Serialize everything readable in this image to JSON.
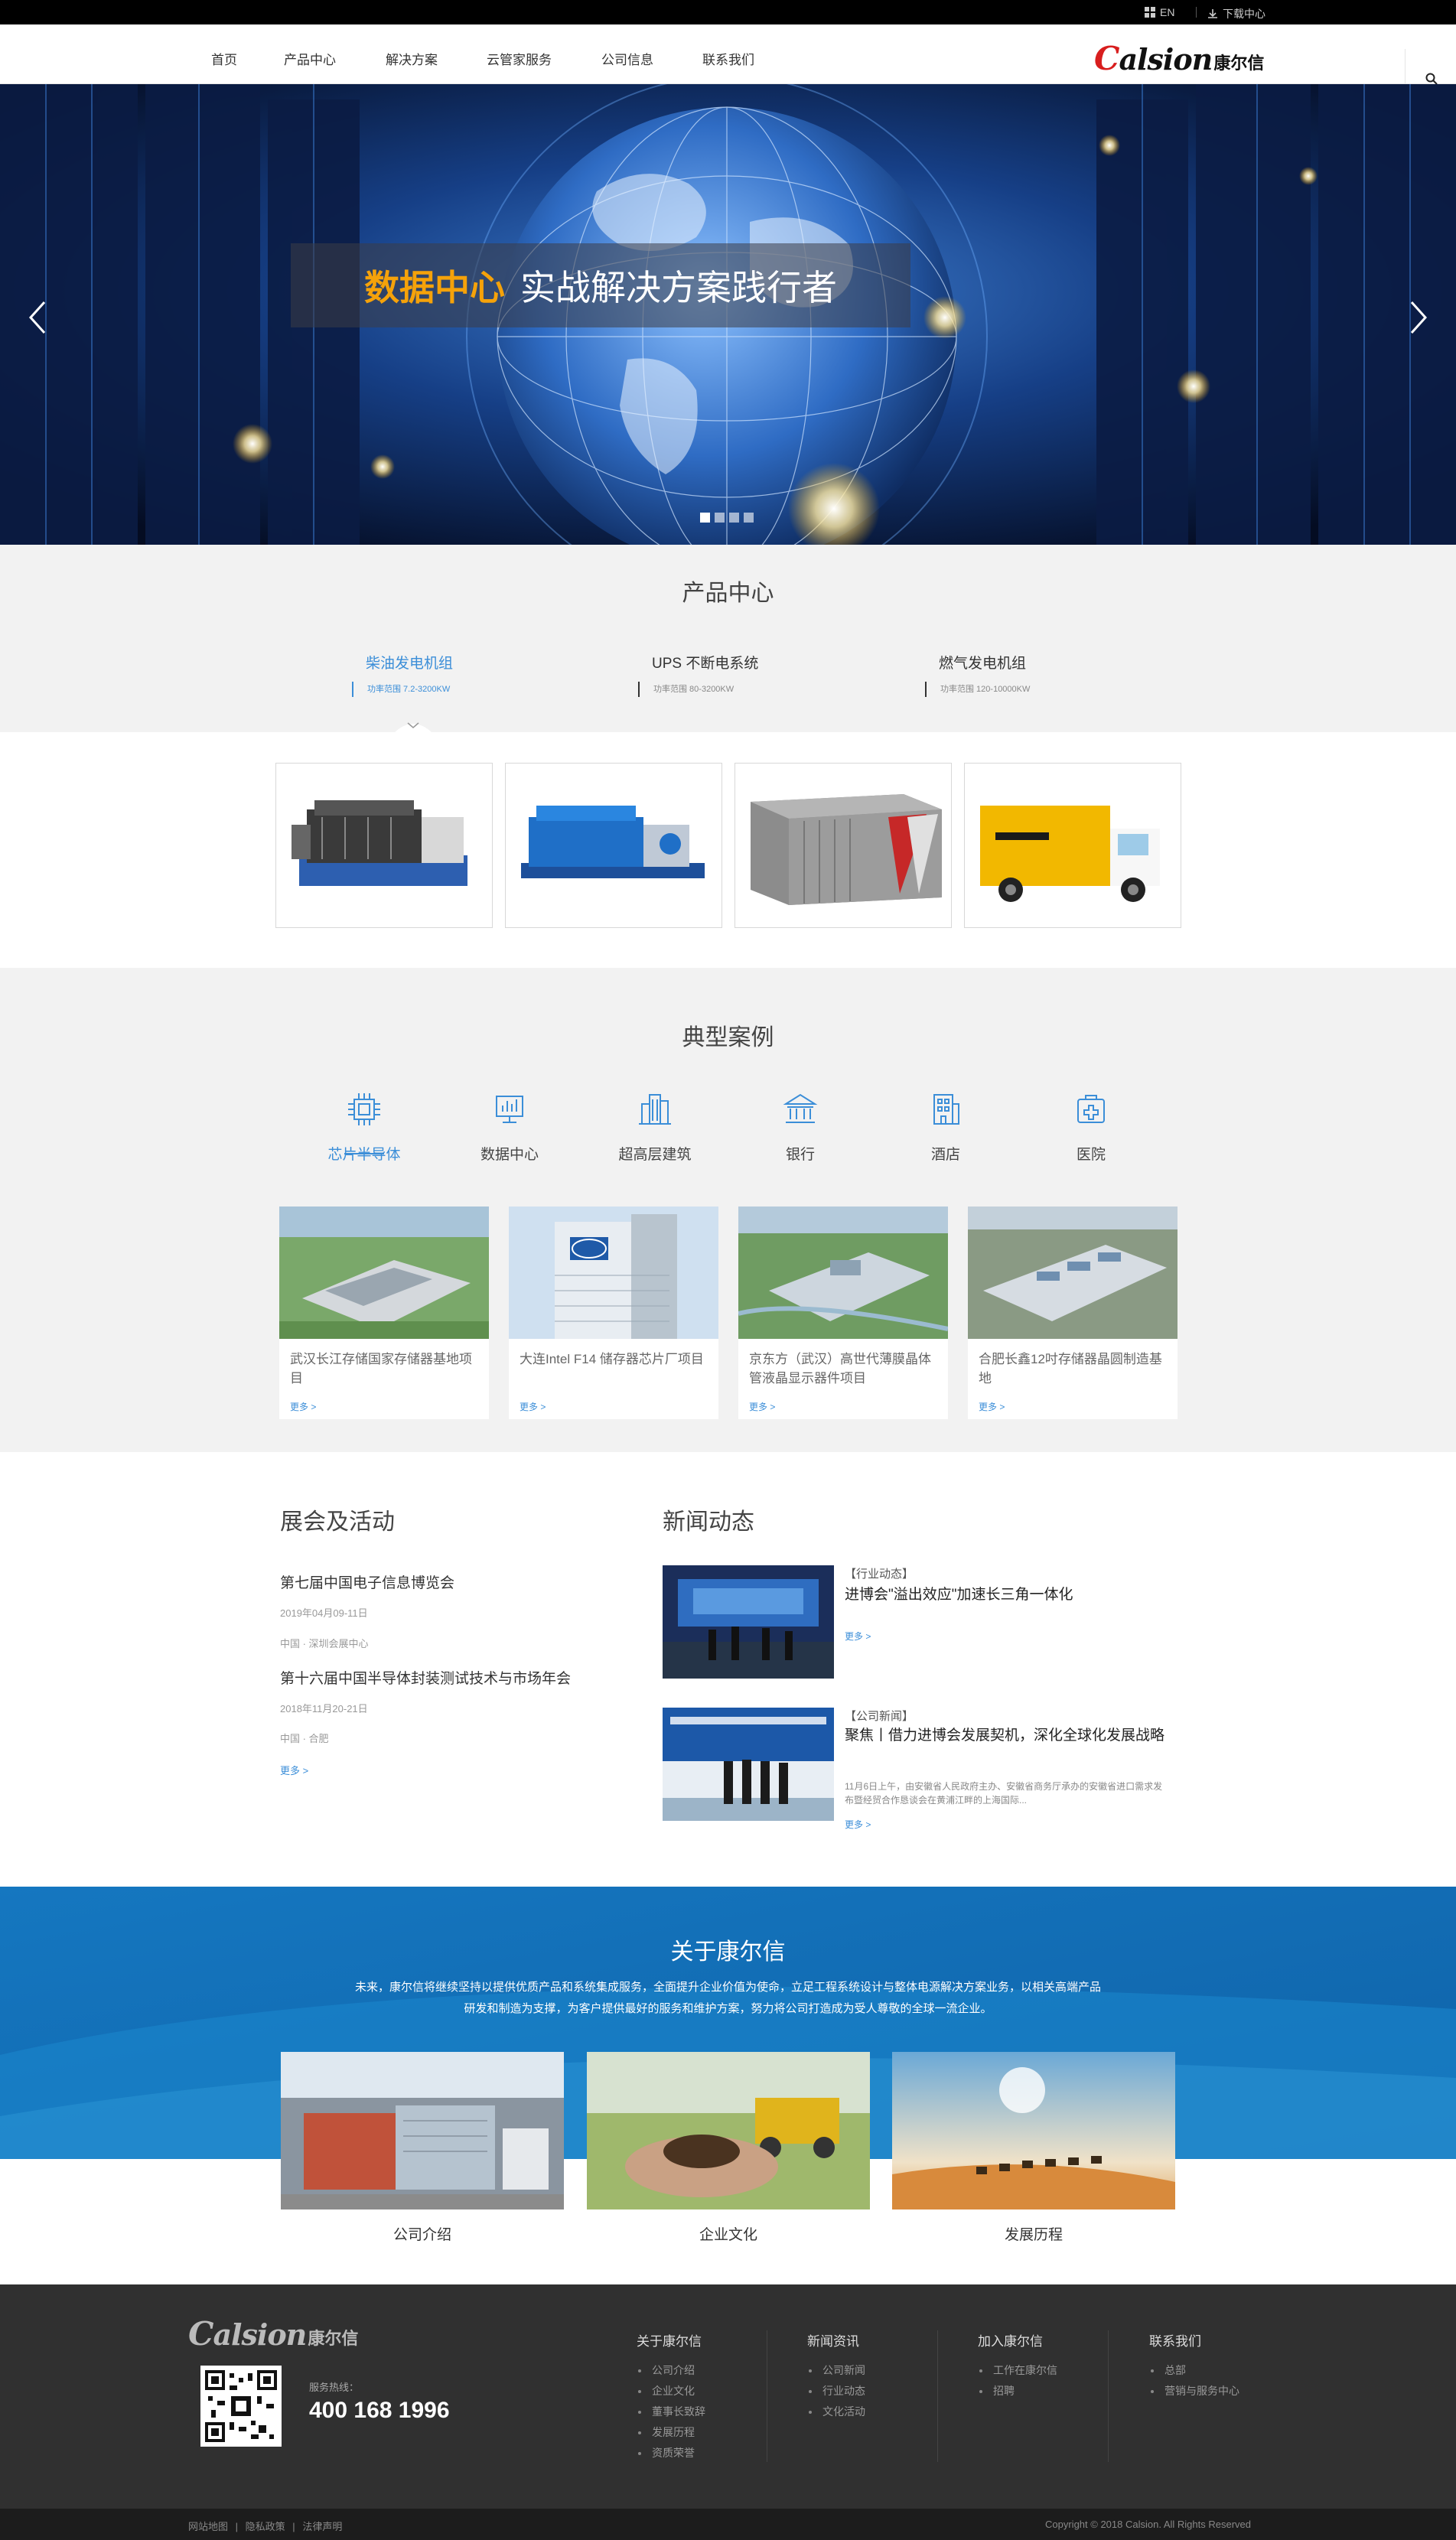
{
  "topbar": {
    "lang": "EN",
    "download": "下载中心"
  },
  "nav": {
    "items": [
      "首页",
      "产品中心",
      "解决方案",
      "云管家服务",
      "公司信息",
      "联系我们"
    ]
  },
  "logo": {
    "en_initial": "C",
    "en_rest": "alsion",
    "cn": "康尔信"
  },
  "banner": {
    "highlight": "数据中心",
    "caption": "实战解决方案践行者",
    "slide_count": 4,
    "active_slide": 1
  },
  "products": {
    "title": "产品中心",
    "tabs": [
      {
        "name": "柴油发电机组",
        "sub": "功率范围 7.2-3200KW",
        "active": true
      },
      {
        "name": "UPS 不断电系统",
        "sub": "功率范围 80-3200KW",
        "active": false
      },
      {
        "name": "燃气发电机组",
        "sub": "功率范围 120-10000KW",
        "active": false
      }
    ]
  },
  "cases": {
    "title": "典型案例",
    "categories": [
      {
        "label": "芯片半导体",
        "icon": "chip-icon",
        "active": true
      },
      {
        "label": "数据中心",
        "icon": "data-center-icon",
        "active": false
      },
      {
        "label": "超高层建筑",
        "icon": "skyscraper-icon",
        "active": false
      },
      {
        "label": "银行",
        "icon": "bank-icon",
        "active": false
      },
      {
        "label": "酒店",
        "icon": "hotel-icon",
        "active": false
      },
      {
        "label": "医院",
        "icon": "hospital-icon",
        "active": false
      }
    ],
    "items": [
      {
        "title": "武汉长江存储国家存储器基地项目",
        "more": "更多 >"
      },
      {
        "title": "大连Intel F14 储存器芯片厂项目",
        "more": "更多 >"
      },
      {
        "title": "京东方（武汉）高世代薄膜晶体管液晶显示器件项目",
        "more": "更多 >"
      },
      {
        "title": "合肥长鑫12吋存储器晶圆制造基地",
        "more": "更多 >"
      }
    ]
  },
  "events": {
    "title": "展会及活动",
    "items": [
      {
        "title": "第七届中国电子信息博览会",
        "date": "2019年04月09-11日",
        "place": "中国 · 深圳会展中心"
      },
      {
        "title": "第十六届中国半导体封装测试技术与市场年会",
        "date": "2018年11月20-21日",
        "place": "中国 · 合肥"
      }
    ],
    "more": "更多 >"
  },
  "news": {
    "title": "新闻动态",
    "items": [
      {
        "tag": "【行业动态】",
        "title": "进博会\"溢出效应\"加速长三角一体化",
        "desc": "",
        "more": "更多 >"
      },
      {
        "tag": "【公司新闻】",
        "title": "聚焦丨借力进博会发展契机，深化全球化发展战略",
        "desc": "11月6日上午，由安徽省人民政府主办、安徽省商务厅承办的安徽省进口需求发布暨经贸合作恳谈会在黄浦江畔的上海国际...",
        "more": "更多 >"
      }
    ]
  },
  "about": {
    "title": "关于康尔信",
    "text": "未来，康尔信将继续坚持以提供优质产品和系统集成服务，全面提升企业价值为使命，立足工程系统设计与整体电源解决方案业务，以相关高端产品研发和制造为支撑，为客户提供最好的服务和维护方案，努力将公司打造成为受人尊敬的全球一流企业。",
    "cards": [
      "公司介绍",
      "企业文化",
      "发展历程"
    ]
  },
  "footer": {
    "hotline_label": "服务热线：",
    "hotline": "400 168 1996",
    "columns": [
      {
        "title": "关于康尔信",
        "items": [
          "公司介绍",
          "企业文化",
          "董事长致辞",
          "发展历程",
          "资质荣誉"
        ]
      },
      {
        "title": "新闻资讯",
        "items": [
          "公司新闻",
          "行业动态",
          "文化活动"
        ]
      },
      {
        "title": "加入康尔信",
        "items": [
          "工作在康尔信",
          "招聘"
        ]
      },
      {
        "title": "联系我们",
        "items": [
          "总部",
          "营销与服务中心"
        ]
      }
    ],
    "links": [
      "网站地图",
      "|",
      "隐私政策",
      "|",
      "法律声明"
    ],
    "copyright": "Copyright © 2018 Calsion. All Rights Reserved"
  },
  "colors": {
    "accent": "#3b8ed8",
    "banner_highlight": "#f5a20a",
    "about_blue": "#1a7cc0",
    "footer_bg": "#303030"
  }
}
